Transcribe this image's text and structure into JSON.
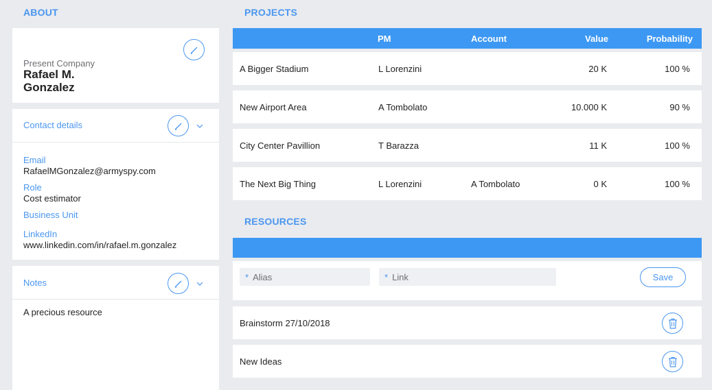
{
  "about": {
    "title": "ABOUT",
    "company_label": "Present Company",
    "name_line1": "Rafael M.",
    "name_line2": "Gonzalez",
    "contact": {
      "title": "Contact details",
      "email_label": "Email",
      "email_value": "RafaelMGonzalez@armyspy.com",
      "role_label": "Role",
      "role_value": "Cost estimator",
      "bu_label": "Business Unit",
      "bu_value": "",
      "linkedin_label": "LinkedIn",
      "linkedin_value": "www.linkedin.com/in/rafael.m.gonzalez"
    },
    "notes": {
      "title": "Notes",
      "text": "A precious resource"
    }
  },
  "projects": {
    "title": "PROJECTS",
    "columns": [
      "",
      "PM",
      "Account",
      "Value",
      "Probability"
    ],
    "rows": [
      {
        "name": "A Bigger Stadium",
        "pm": "L Lorenzini",
        "account": "",
        "value": "20 K",
        "probability": "100 %"
      },
      {
        "name": "New Airport Area",
        "pm": "A Tombolato",
        "account": "",
        "value": "10.000 K",
        "probability": "90 %"
      },
      {
        "name": "City Center Pavillion",
        "pm": "T Barazza",
        "account": "",
        "value": "11 K",
        "probability": "100 %"
      },
      {
        "name": "The Next Big Thing",
        "pm": "L Lorenzini",
        "account": "A Tombolato",
        "value": "0 K",
        "probability": "100 %"
      }
    ]
  },
  "resources": {
    "title": "RESOURCES",
    "alias_placeholder": "Alias",
    "link_placeholder": "Link",
    "required_mark": "*",
    "save_label": "Save",
    "items": [
      {
        "name": "Brainstorm 27/10/2018"
      },
      {
        "name": "New Ideas"
      }
    ]
  },
  "icons": {
    "edit": "pencil-icon",
    "expand": "chevron-down-icon",
    "delete": "trash-icon"
  },
  "colors": {
    "accent": "#4a96ef",
    "header_bar": "#3d98f3",
    "background": "#e9ebef"
  }
}
